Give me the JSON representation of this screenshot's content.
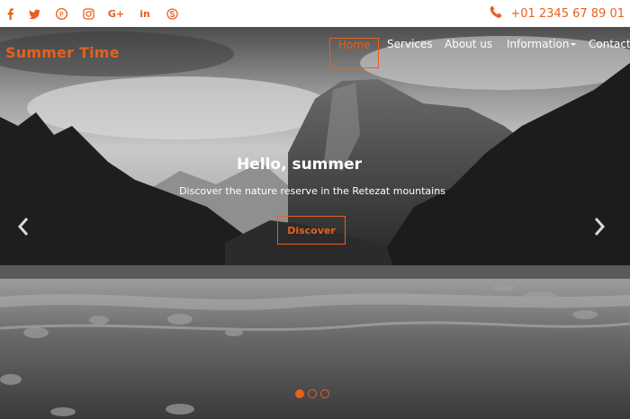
{
  "topbar": {
    "social": [
      {
        "name": "facebook"
      },
      {
        "name": "twitter"
      },
      {
        "name": "pinterest"
      },
      {
        "name": "instagram"
      },
      {
        "name": "google-plus",
        "glyph": "G+"
      },
      {
        "name": "linkedin",
        "glyph": "in"
      },
      {
        "name": "skype"
      }
    ],
    "phone": "+01 2345 67 89 01"
  },
  "brand": "Summer Time",
  "nav": {
    "items": [
      {
        "label": "Home",
        "active": true
      },
      {
        "label": "Services"
      },
      {
        "label": "About us"
      },
      {
        "label": "Information",
        "dropdown": true
      },
      {
        "label": "Contact"
      }
    ]
  },
  "hero": {
    "title": "Hello, summer",
    "subtitle": "Discover the nature reserve in the Retezat mountains",
    "cta": "Discover",
    "slides": 3,
    "active_slide": 1
  },
  "colors": {
    "accent": "#e8601c",
    "topbar_bg": "#ffffff"
  }
}
